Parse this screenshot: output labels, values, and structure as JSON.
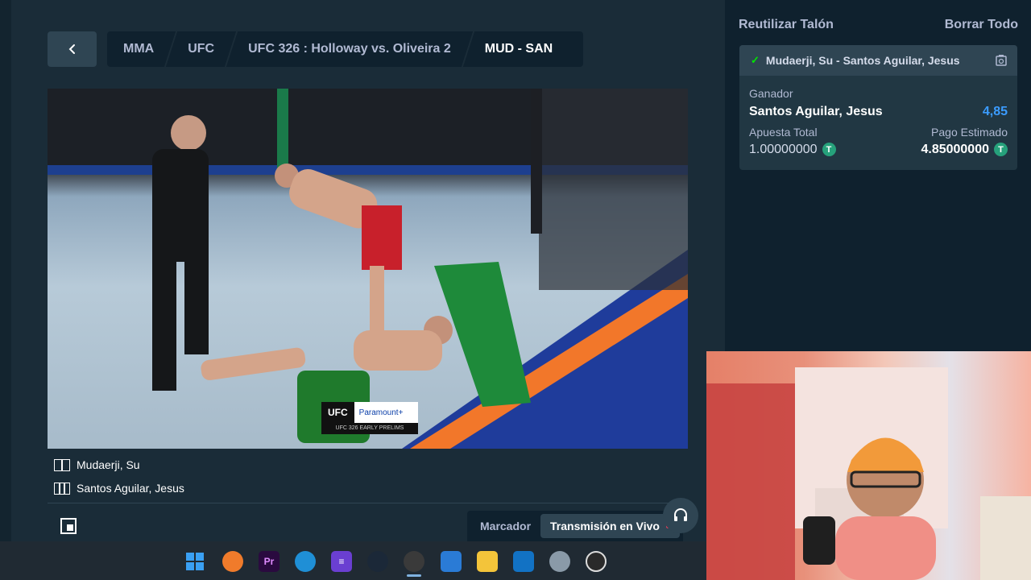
{
  "breadcrumb": [
    "MMA",
    "UFC",
    "UFC 326 : Holloway vs. Oliveira 2",
    "MUD - SAN"
  ],
  "video": {
    "overlay_brand": "UFC",
    "overlay_partner": "Paramount+",
    "overlay_caption": "UFC 326 EARLY PRELIMS"
  },
  "fighters": [
    "Mudaerji, Su",
    "Santos Aguilar, Jesus"
  ],
  "tabs": {
    "scoreboard": "Marcador",
    "live": "Transmisión en Vivo"
  },
  "betslip": {
    "reuse_label": "Reutilizar Talón",
    "clear_label": "Borrar Todo",
    "bet": {
      "event": "Mudaerji, Su - Santos Aguilar, Jesus",
      "market": "Ganador",
      "selection": "Santos Aguilar, Jesus",
      "odds": "4,85",
      "stake_label": "Apuesta Total",
      "stake": "1.00000000",
      "payout_label": "Pago Estimado",
      "payout": "4.85000000",
      "currency_glyph": "T"
    }
  },
  "taskbar": {
    "icons": [
      "windows-start-icon",
      "fl-studio-icon",
      "premiere-pro-icon",
      "edge-icon",
      "editor-icon",
      "steam-icon",
      "browser-icon",
      "store-icon",
      "file-explorer-icon",
      "outlook-icon",
      "settings-icon",
      "obs-icon"
    ]
  },
  "colors": {
    "bg": "#0f212e",
    "panel": "#1a2c38",
    "accent_green": "#00e701",
    "odds_blue": "#3b9cff",
    "live_dot": "#ff3c5a"
  }
}
